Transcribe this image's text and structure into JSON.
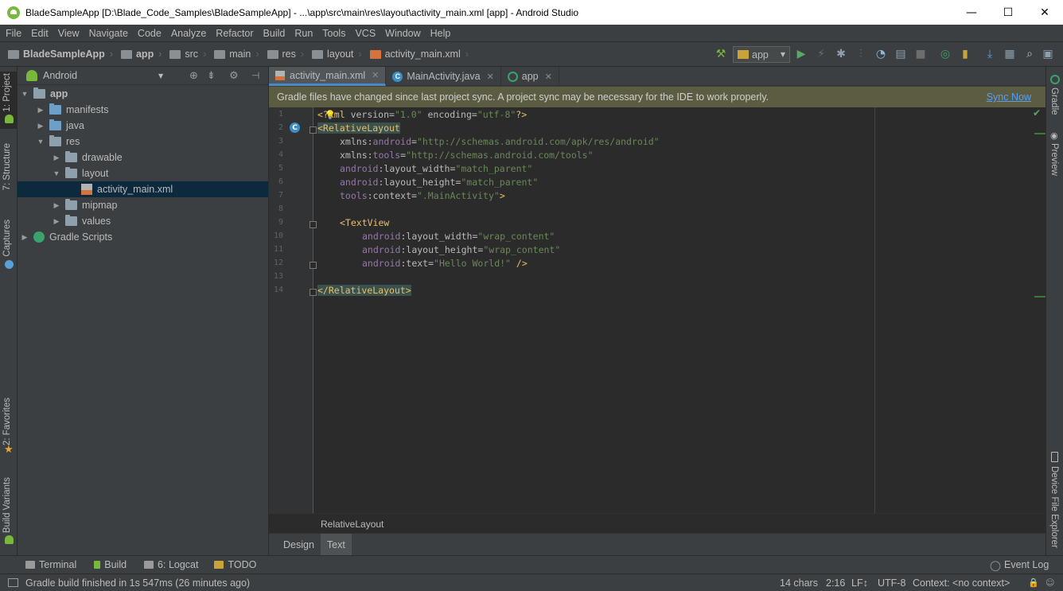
{
  "window": {
    "title": "BladeSampleApp [D:\\Blade_Code_Samples\\BladeSampleApp] - ...\\app\\src\\main\\res\\layout\\activity_main.xml [app] - Android Studio",
    "controls": {
      "minimize": "—",
      "maximize": "☐",
      "close": "✕"
    }
  },
  "menu": [
    "File",
    "Edit",
    "View",
    "Navigate",
    "Code",
    "Analyze",
    "Refactor",
    "Build",
    "Run",
    "Tools",
    "VCS",
    "Window",
    "Help"
  ],
  "breadcrumbs": [
    "BladeSampleApp",
    "app",
    "src",
    "main",
    "res",
    "layout",
    "activity_main.xml"
  ],
  "toolbar": {
    "run_config": "app",
    "run_config_arrow": "▼"
  },
  "left_tool_windows": [
    "1: Project",
    "7: Structure",
    "Captures",
    "2: Favorites",
    "Build Variants"
  ],
  "right_tool_windows": [
    "Gradle",
    "Preview",
    "Device File Explorer"
  ],
  "project_panel": {
    "view_mode": "Android",
    "view_mode_arrow": "▼",
    "tree": [
      {
        "label": "app",
        "arrow": "▼"
      },
      {
        "label": "manifests",
        "arrow": "▶"
      },
      {
        "label": "java",
        "arrow": "▶"
      },
      {
        "label": "res",
        "arrow": "▼"
      },
      {
        "label": "drawable",
        "arrow": "▶"
      },
      {
        "label": "layout",
        "arrow": "▼"
      },
      {
        "label": "activity_main.xml",
        "arrow": ""
      },
      {
        "label": "mipmap",
        "arrow": "▶"
      },
      {
        "label": "values",
        "arrow": "▶"
      },
      {
        "label": "Gradle Scripts",
        "arrow": "▶"
      }
    ]
  },
  "editor_tabs": [
    {
      "label": "activity_main.xml",
      "close": "✕"
    },
    {
      "label": "MainActivity.java",
      "close": "✕"
    },
    {
      "label": "app",
      "close": "✕"
    }
  ],
  "banner": {
    "message": "Gradle files have changed since last project sync. A project sync may be necessary for the IDE to work properly.",
    "action": "Sync Now"
  },
  "code": {
    "line_numbers": [
      "1",
      "2",
      "3",
      "4",
      "5",
      "6",
      "7",
      "8",
      "9",
      "10",
      "11",
      "12",
      "13",
      "14"
    ],
    "lines": {
      "l1": {
        "pre": "<?",
        "tag": "xml",
        "attrs": " version=",
        "v1": "\"1.0\"",
        "attrs2": " encoding=",
        "v2": "\"utf-8\"",
        "end": "?>"
      },
      "l2": {
        "tag": "<RelativeLayout"
      },
      "l3": {
        "ns": "xmlns:",
        "attr": "android",
        "eq": "=",
        "val": "\"http://schemas.android.com/apk/res/android\""
      },
      "l4": {
        "ns": "xmlns:",
        "attr": "tools",
        "eq": "=",
        "val": "\"http://schemas.android.com/tools\""
      },
      "l5": {
        "ns": "android",
        "attr": ":layout_width",
        "eq": "=",
        "val": "\"match_parent\""
      },
      "l6": {
        "ns": "android",
        "attr": ":layout_height",
        "eq": "=",
        "val": "\"match_parent\""
      },
      "l7": {
        "ns": "tools",
        "attr": ":context",
        "eq": "=",
        "val": "\".MainActivity\"",
        "end": ">"
      },
      "l9": {
        "tag": "<TextView"
      },
      "l10": {
        "ns": "android",
        "attr": ":layout_width",
        "eq": "=",
        "val": "\"wrap_content\""
      },
      "l11": {
        "ns": "android",
        "attr": ":layout_height",
        "eq": "=",
        "val": "\"wrap_content\""
      },
      "l12": {
        "ns": "android",
        "attr": ":text",
        "eq": "=",
        "val": "\"Hello World!\"",
        "end": " />"
      },
      "l14": {
        "tag": "</RelativeLayout>"
      }
    },
    "gutter_badge": "C"
  },
  "editor_breadcrumb": "RelativeLayout",
  "design_tabs": [
    "Design",
    "Text"
  ],
  "bottom_tools": [
    {
      "label": "Terminal"
    },
    {
      "label": "Build"
    },
    {
      "label": "6: Logcat"
    },
    {
      "label": "TODO"
    }
  ],
  "event_log": "Event Log",
  "status": {
    "message": "Gradle build finished in 1s 547ms (26 minutes ago)",
    "chars": "14 chars",
    "position": "2:16",
    "line_sep": "LF↕",
    "encoding": "UTF-8",
    "context": "Context: <no context>"
  }
}
